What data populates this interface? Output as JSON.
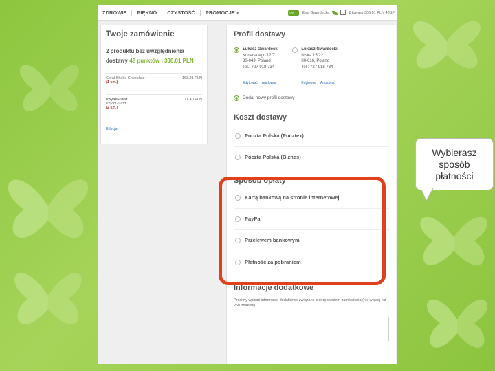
{
  "nav": {
    "items": [
      "ZDROWIE",
      "PIĘKNO",
      "CZYSTOŚĆ",
      "PROMOCJE"
    ],
    "promo_suffix": "»",
    "toggle": "ON",
    "user": "Ewa Gwardecka",
    "cart": "2 towaru  306.01 PLN  48BP"
  },
  "order": {
    "title": "Twoje zamówienie",
    "summary_line1": "2 produktu bez uwzględnienia",
    "summary_prefix": "dostawy",
    "points": "48 punktów",
    "summary_and": "i",
    "total": "306.01 PLN",
    "items": [
      {
        "name": "Coral Shake Chocolate",
        "sub": "",
        "qty": "(1 szt.)",
        "price": "163.21 PLN"
      },
      {
        "name": "PhytoGuard",
        "sub": "PhytoGuard",
        "qty": "(2 szt.)",
        "price": "71.40 PLN"
      }
    ],
    "edit_link": "Edycja"
  },
  "delivery_profile": {
    "title": "Profil dostawy",
    "addresses": [
      {
        "name": "Łukasz Gwardecki",
        "line1": "Konarskiego 12/7",
        "line2": "30-049, Poland",
        "phone": "Tel.: 727 918 734",
        "selected": true
      },
      {
        "name": "Łukasz Gwardecki",
        "line1": "Niska 15/22",
        "line2": "80-616, Poland",
        "phone": "Tel.: 727 918 734",
        "selected": false
      }
    ],
    "edit": "Edytować",
    "delete": "Anulować",
    "add_new": "Dodaj nowy profil dostawy"
  },
  "shipping": {
    "title": "Koszt dostawy",
    "options": [
      "Poczta Polska (Pocztex)",
      "Poczta Polska (Biznes)"
    ]
  },
  "payment": {
    "title": "Sposób opłaty",
    "options": [
      "Kartą bankową na stronie internetowej",
      "PayPal",
      "Przelewem bankowym",
      "Płatność za pobraniem"
    ]
  },
  "additional": {
    "title": "Informacje dodatkowe",
    "hint": "Prosimy wpisać informacje dodatkowe związane z doręczeniem zamówienia (nie więcej niż 250 znaków)"
  },
  "callout": {
    "text": "Wybierasz sposób płatności"
  },
  "colors": {
    "background": "#8dc63f",
    "accent_green": "#79b52c",
    "highlight": "#e0401c"
  }
}
